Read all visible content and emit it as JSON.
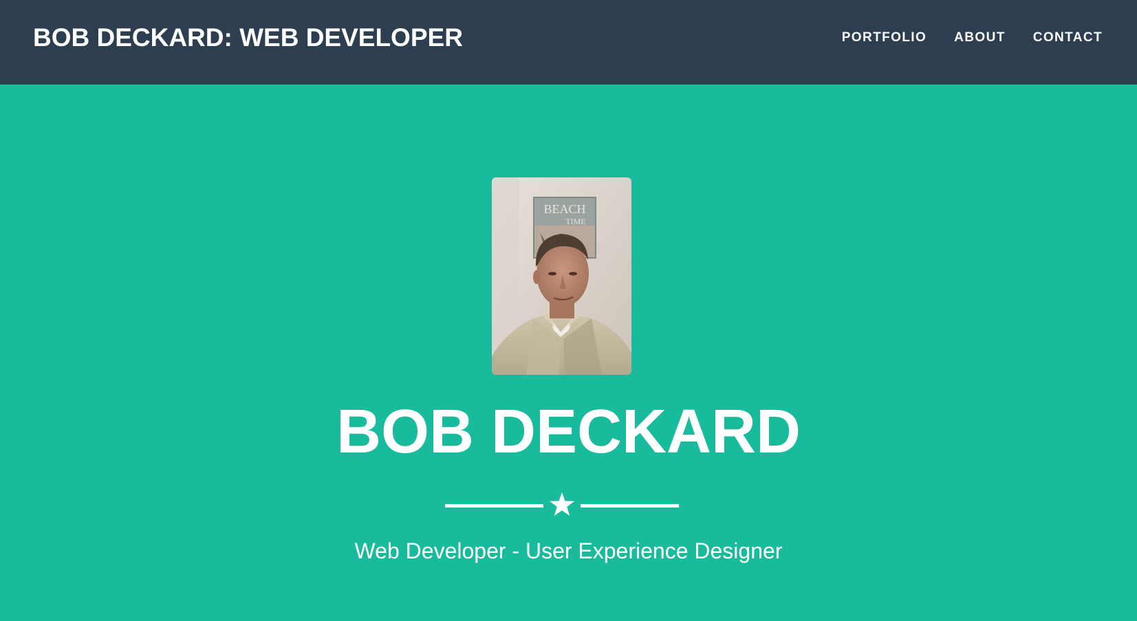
{
  "navbar": {
    "brand": "BOB DECKARD: WEB DEVELOPER",
    "links": [
      {
        "label": "PORTFOLIO"
      },
      {
        "label": "ABOUT"
      },
      {
        "label": "CONTACT"
      }
    ]
  },
  "hero": {
    "photo_alt": "Bob Deckard profile photo",
    "poster_text_line1": "BEACH",
    "poster_text_line2": "TIME",
    "name": "BOB DECKARD",
    "divider_icon": "star-icon",
    "tagline": "Web Developer - User Experience Designer"
  },
  "colors": {
    "navbar_bg": "#2c3e50",
    "hero_bg": "#18bc9c",
    "text": "#ffffff"
  }
}
